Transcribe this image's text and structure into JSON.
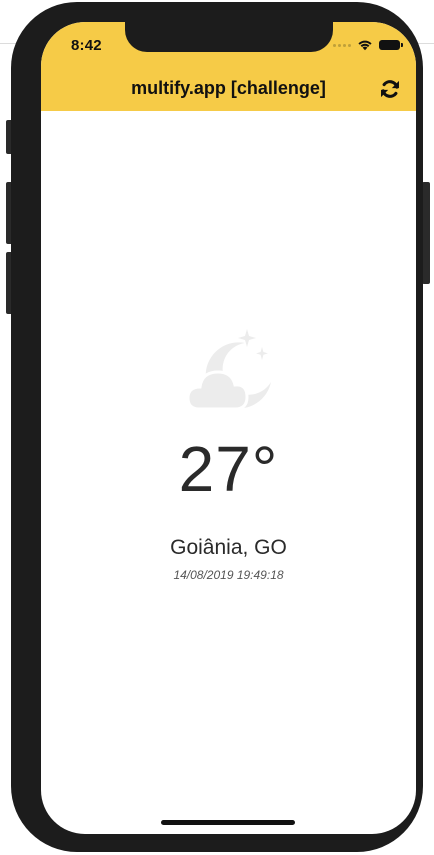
{
  "status_bar": {
    "time": "8:42"
  },
  "header": {
    "title": "multify.app [challenge]",
    "background_color": "#f6cb47",
    "refresh_icon": "refresh-icon"
  },
  "weather": {
    "icon": "night-partly-cloudy-icon",
    "temperature": "27°",
    "location": "Goiânia, GO",
    "updated_at": "14/08/2019 19:49:18"
  }
}
